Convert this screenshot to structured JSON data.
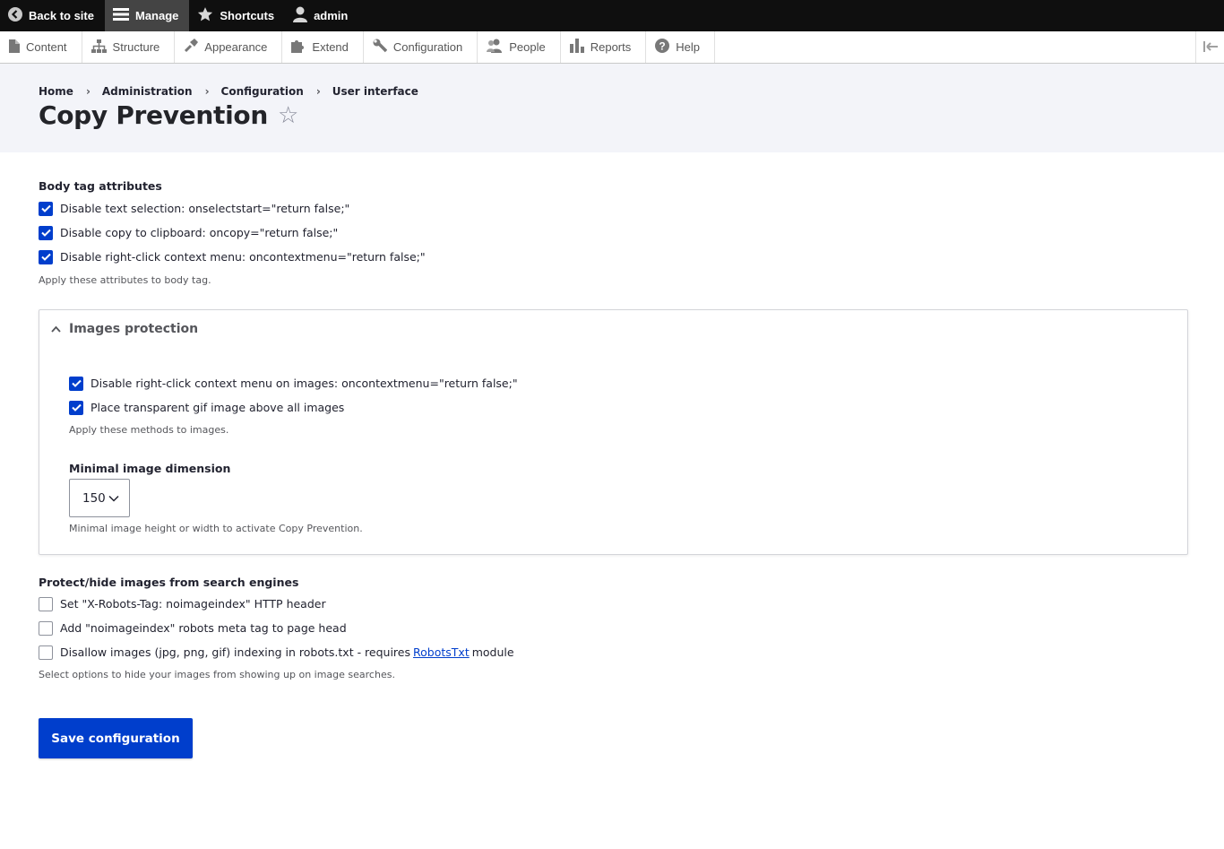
{
  "toolbar": {
    "back_to_site": "Back to site",
    "manage": "Manage",
    "shortcuts": "Shortcuts",
    "user": "admin"
  },
  "admin_menu": {
    "items": [
      {
        "label": "Content",
        "icon": "file-icon"
      },
      {
        "label": "Structure",
        "icon": "sitemap-icon"
      },
      {
        "label": "Appearance",
        "icon": "paintbrush-icon"
      },
      {
        "label": "Extend",
        "icon": "puzzle-icon"
      },
      {
        "label": "Configuration",
        "icon": "wrench-icon"
      },
      {
        "label": "People",
        "icon": "people-icon"
      },
      {
        "label": "Reports",
        "icon": "bar-chart-icon"
      },
      {
        "label": "Help",
        "icon": "help-icon"
      }
    ]
  },
  "breadcrumb": [
    "Home",
    "Administration",
    "Configuration",
    "User interface"
  ],
  "page_title": "Copy Prevention",
  "body_attrs": {
    "label": "Body tag attributes",
    "options": [
      {
        "label": "Disable text selection: onselectstart=\"return false;\"",
        "checked": true
      },
      {
        "label": "Disable copy to clipboard: oncopy=\"return false;\"",
        "checked": true
      },
      {
        "label": "Disable right-click context menu: oncontextmenu=\"return false;\"",
        "checked": true
      }
    ],
    "description": "Apply these attributes to body tag."
  },
  "images_protection": {
    "summary": "Images protection",
    "options": [
      {
        "label": "Disable right-click context menu on images: oncontextmenu=\"return false;\"",
        "checked": true
      },
      {
        "label": "Place transparent gif image above all images",
        "checked": true
      }
    ],
    "description": "Apply these methods to images.",
    "dimension_label": "Minimal image dimension",
    "dimension_value": "150",
    "dimension_description": "Minimal image height or width to activate Copy Prevention."
  },
  "search_engines": {
    "label": "Protect/hide images from search engines",
    "option1": "Set \"X-Robots-Tag: noimageindex\" HTTP header",
    "option2": "Add \"noimageindex\" robots meta tag to page head",
    "option3_before": "Disallow images (jpg, png, gif) indexing in robots.txt - requires",
    "option3_link": "RobotsTxt",
    "option3_after": "module",
    "option1_checked": false,
    "option2_checked": false,
    "option3_checked": false,
    "description": "Select options to hide your images from showing up on image searches."
  },
  "save_label": "Save configuration",
  "colors": {
    "accent": "#003ecc",
    "toolbar_bg": "#0f0f0f",
    "header_bg": "#f3f4f9"
  }
}
